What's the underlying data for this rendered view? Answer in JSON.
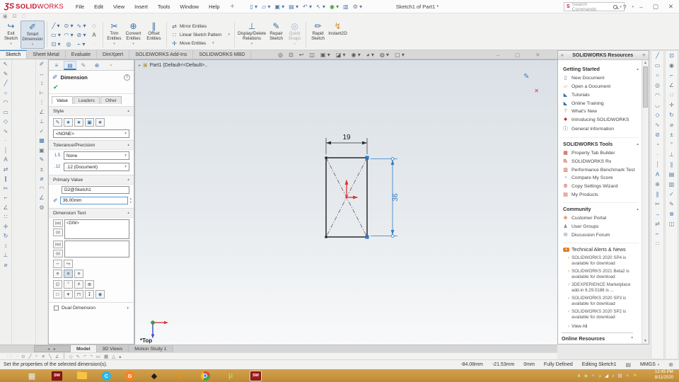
{
  "titlebar": {
    "logo_mark": "ƷS",
    "logo_solid": "SOLID",
    "logo_works": "WORKS",
    "menus": [
      "File",
      "Edit",
      "View",
      "Insert",
      "Tools",
      "Window",
      "Help"
    ],
    "quick_access": [
      {
        "name": "new-document-icon",
        "glyph": "▯ ▾"
      },
      {
        "name": "open-icon",
        "glyph": "▱ ▾"
      },
      {
        "name": "save-icon",
        "glyph": "▣ ▾"
      },
      {
        "name": "print-icon",
        "glyph": "▤ ▾"
      },
      {
        "name": "undo-icon",
        "glyph": "↶ ▾"
      },
      {
        "name": "select-icon",
        "glyph": "↖ ▾"
      },
      {
        "name": "rebuild-icon",
        "glyph": "◉ ▾",
        "color": "#3f9b3f"
      },
      {
        "name": "file-properties-icon",
        "glyph": "▥"
      },
      {
        "name": "options-icon",
        "glyph": "⚙ ▾",
        "color": "#6b7d91"
      }
    ],
    "title": "Sketch1 of Part1 *",
    "search_placeholder": "Search Commands"
  },
  "ribbon": {
    "capture_icons": [
      {
        "name": "screenshot-icon",
        "glyph": "▣"
      },
      {
        "name": "record-video-icon",
        "glyph": "⊡"
      },
      {
        "name": "image-capture-icon",
        "glyph": "▢",
        "color": "#c4c4c4"
      }
    ],
    "exit_sketch": "Exit Sketch",
    "smart_dimension": "Smart Dimension",
    "sketch_tool_icons": [
      {
        "name": "line-icon",
        "glyph": "╱ ▾"
      },
      {
        "name": "circle-icon",
        "glyph": "⊙ ▾"
      },
      {
        "name": "spline-icon",
        "glyph": "∿ ▾"
      },
      {
        "name": "polygon-icon",
        "glyph": "◇",
        "color": "#b5b5b5"
      },
      {
        "name": "corner-rectangle-icon",
        "glyph": "▭ ▾"
      },
      {
        "name": "arc-icon",
        "glyph": "◠ ▾"
      },
      {
        "name": "ellipse-icon",
        "glyph": "⊘ ▾"
      },
      {
        "name": "sketch-text-icon",
        "glyph": "A",
        "color": "#555555"
      },
      {
        "name": "slot-icon",
        "glyph": "⊡ ▾"
      },
      {
        "name": "point-icon",
        "glyph": "◎"
      },
      {
        "name": "sketch-fillet-icon",
        "glyph": "⌐ ▾"
      },
      {
        "name": "plane-icon",
        "glyph": "·",
        "color": "#b5b5b5"
      }
    ],
    "trim": "Trim Entities",
    "convert": "Convert Entities",
    "offset": "Offset Entities",
    "mirror": "Mirror Entities",
    "linear_pattern": "Linear Sketch Pattern",
    "move": "Move Entities",
    "display_delete": "Display/Delete Relations",
    "repair": "Repair Sketch",
    "quick_snaps": "Quick Snaps",
    "rapid": "Rapid Sketch",
    "instant2d": "Instant2D",
    "tabs": [
      "Sketch",
      "Sheet Metal",
      "Evaluate",
      "DimXpert",
      "SOLIDWORKS Add-Ins",
      "SOLIDWORKS MBD"
    ]
  },
  "property_panel": {
    "title": "Dimension",
    "tabs": [
      "Value",
      "Leaders",
      "Other"
    ],
    "style_label": "Style",
    "style_selected": "<NONE>",
    "tolerance_label": "Tolerance/Precision",
    "tol_icon": "1.5",
    "tolerance_type": "None",
    "prec_icon": ".12",
    "precision": ".12 (Document)",
    "primary_label": "Primary Value",
    "primary_name": "D2@Sketch1",
    "primary_value": "36.00mm",
    "dimension_text_label": "Dimension Text",
    "dim_btn1": "(xx)",
    "dim_btn2": "(x)",
    "dimension_text_value": "<DIM>",
    "dual_label": "Dual Dimension"
  },
  "viewport": {
    "feature_tree": "Part1 (Default<<Default>..",
    "view_label": "*Top",
    "width_dim": "19",
    "height_dim": "36",
    "doc_tabs": [
      "Model",
      "3D Views",
      "Motion Study 1"
    ],
    "headsup_icons": [
      {
        "name": "zoom-fit-icon",
        "glyph": "◎"
      },
      {
        "name": "zoom-area-icon",
        "glyph": "⊡"
      },
      {
        "name": "previous-view-icon",
        "glyph": "↩"
      },
      {
        "name": "section-view-icon",
        "glyph": "◫"
      },
      {
        "name": "view-orientation-icon",
        "glyph": "▣ ▾"
      },
      {
        "name": "display-style-icon",
        "glyph": "◪ ▾"
      },
      {
        "name": "hide-show-items-icon",
        "glyph": "◉ ▾"
      },
      {
        "name": "edit-appearance-icon",
        "glyph": "◕ ▾"
      },
      {
        "name": "apply-scene-icon",
        "glyph": "◍ ▾"
      },
      {
        "name": "view-settings-icon",
        "glyph": "▢ ▾"
      }
    ]
  },
  "task_pane": {
    "title": "SOLIDWORKS Resources",
    "getting_started": {
      "title": "Getting Started",
      "items": [
        {
          "name": "new-document",
          "label": "New Document",
          "glyph": "▯",
          "color": "#5b7aa8"
        },
        {
          "name": "open-a-document",
          "label": "Open a Document",
          "glyph": "▱",
          "color": "#d9a13b"
        },
        {
          "name": "tutorials",
          "label": "Tutorials",
          "glyph": "◣",
          "color": "#2e6da4"
        },
        {
          "name": "online-training",
          "label": "Online Training",
          "glyph": "◣",
          "color": "#2e6da4"
        },
        {
          "name": "whats-new",
          "label": "What's New",
          "glyph": "?",
          "color": "#e08a2e"
        },
        {
          "name": "introducing-solidworks",
          "label": "Introducing SOLIDWORKS",
          "glyph": "✸",
          "color": "#c0392b"
        },
        {
          "name": "general-information",
          "label": "General Information",
          "glyph": "ⓘ",
          "color": "#2e6da4"
        }
      ]
    },
    "tools": {
      "title": "SOLIDWORKS Tools",
      "items": [
        {
          "name": "property-tab-builder",
          "label": "Property Tab Builder",
          "glyph": "▦",
          "color": "#c0392b"
        },
        {
          "name": "solidworks-rx",
          "label": "SOLIDWORKS Rx",
          "glyph": "℞",
          "color": "#c0392b"
        },
        {
          "name": "performance-benchmark-test",
          "label": "Performance Benchmark Test",
          "glyph": "▥",
          "color": "#c0392b"
        },
        {
          "name": "compare-my-score",
          "label": "Compare My Score",
          "glyph": "◔",
          "color": "#2980b9"
        },
        {
          "name": "copy-settings-wizard",
          "label": "Copy Settings Wizard",
          "glyph": "⚙",
          "color": "#c0392b"
        },
        {
          "name": "my-products",
          "label": "My Products",
          "glyph": "▤",
          "color": "#c0392b"
        }
      ]
    },
    "community": {
      "title": "Community",
      "items": [
        {
          "name": "customer-portal",
          "label": "Customer Portal",
          "glyph": "⊕",
          "color": "#d35400"
        },
        {
          "name": "user-groups",
          "label": "User Groups",
          "glyph": "♟",
          "color": "#7f8c8d"
        },
        {
          "name": "discussion-forum",
          "label": "Discussion Forum",
          "glyph": "✉",
          "color": "#5b7aa8"
        }
      ]
    },
    "alerts": {
      "title": "Technical Alerts & News",
      "items": [
        "SOLIDWORKS 2020 SP4 is available for download",
        "SOLIDWORKS 2021 Beta2 is available for download",
        "3DEXPERIENCE Marketplace add-in 6.29.0188 is ...",
        "SOLIDWORKS 2020 SP3 is available for download",
        "SOLIDWORKS 2020 SP2 is available for download"
      ],
      "view_all": "View All"
    },
    "online_resources": "Online Resources"
  },
  "toolbars": {
    "left_primary": [
      {
        "name": "select-icon",
        "glyph": "↖"
      },
      {
        "name": "sketch-icon",
        "glyph": "✎"
      },
      {
        "name": "line-icon",
        "glyph": "╱"
      },
      {
        "name": "circle-icon",
        "glyph": "○"
      },
      {
        "name": "arc-icon",
        "glyph": "◠"
      },
      {
        "name": "rectangle-icon",
        "glyph": "▭"
      },
      {
        "name": "polygon-icon",
        "glyph": "◇"
      },
      {
        "name": "spline-icon",
        "glyph": "∿"
      },
      {
        "name": "point-icon",
        "glyph": "·"
      },
      {
        "name": "centerline-icon",
        "glyph": "┆"
      },
      {
        "name": "text-icon",
        "glyph": "A"
      },
      {
        "name": "mirror-icon",
        "glyph": "⇄"
      },
      {
        "name": "offset-icon",
        "glyph": "∥"
      },
      {
        "name": "trim-icon",
        "glyph": "✂"
      },
      {
        "name": "fillet-icon",
        "glyph": "⌐"
      },
      {
        "name": "chamfer-icon",
        "glyph": "∠"
      },
      {
        "name": "pattern-icon",
        "glyph": "∷"
      },
      {
        "name": "move-icon",
        "glyph": "✛"
      },
      {
        "name": "rotate-icon",
        "glyph": "↻"
      },
      {
        "name": "stretch-icon",
        "glyph": "↕"
      },
      {
        "name": "relations-icon",
        "glyph": "⊥"
      },
      {
        "name": "dimension-icon",
        "glyph": "⌀"
      }
    ],
    "left_secondary": [
      {
        "name": "smart-dimension-icon",
        "glyph": "✐"
      },
      {
        "name": "horizontal-dimension-icon",
        "glyph": "↔"
      },
      {
        "name": "vertical-dimension-icon",
        "glyph": "↕"
      },
      {
        "name": "baseline-dimension-icon",
        "glyph": "⊢"
      },
      {
        "name": "ordinate-dimension-icon",
        "glyph": "⋮"
      },
      {
        "name": "angle-dimension-icon",
        "glyph": "∠"
      },
      {
        "name": "add-relation-icon",
        "glyph": "⊥"
      },
      {
        "name": "display-relations-icon",
        "glyph": "✓"
      },
      {
        "name": "fully-define-sketch-icon",
        "glyph": "▦"
      },
      {
        "name": "sketch-picture-icon",
        "glyph": "▣"
      },
      {
        "name": "modify-sketch-icon",
        "glyph": "✎"
      },
      {
        "name": "numeric-input-icon",
        "glyph": "±"
      },
      {
        "name": "diameter-dimension-icon",
        "glyph": "⌀"
      },
      {
        "name": "radius-dimension-icon",
        "glyph": "◠"
      },
      {
        "name": "chamfer-dimension-icon",
        "glyph": "∠"
      },
      {
        "name": "settings-icon",
        "glyph": "⚙"
      }
    ],
    "right_primary": [
      {
        "name": "line-icon",
        "glyph": "╱"
      },
      {
        "name": "rectangle-icon",
        "glyph": "▭"
      },
      {
        "name": "circle-icon",
        "glyph": "○"
      },
      {
        "name": "perimeter-circle-icon",
        "glyph": "◎"
      },
      {
        "name": "centerpoint-arc-icon",
        "glyph": "◠"
      },
      {
        "name": "tangent-arc-icon",
        "glyph": "◡"
      },
      {
        "name": "polygon-icon",
        "glyph": "◇"
      },
      {
        "name": "spline-icon",
        "glyph": "∿"
      },
      {
        "name": "ellipse-icon",
        "glyph": "⊘"
      },
      {
        "name": "partial-ellipse-icon",
        "glyph": "◔"
      },
      {
        "name": "point-icon",
        "glyph": "·"
      },
      {
        "name": "centerline-icon",
        "glyph": "┆"
      },
      {
        "name": "text-icon",
        "glyph": "A"
      },
      {
        "name": "convert-entities-icon",
        "glyph": "⊕"
      },
      {
        "name": "offset-entities-icon",
        "glyph": "∥"
      },
      {
        "name": "trim-entities-icon",
        "glyph": "✂"
      },
      {
        "name": "extend-entities-icon",
        "glyph": "→"
      },
      {
        "name": "mirror-entities-icon",
        "glyph": "⇄"
      },
      {
        "name": "fillet-icon",
        "glyph": "⌐"
      },
      {
        "name": "pattern-icon",
        "glyph": "∷"
      }
    ],
    "right_secondary": [
      {
        "name": "slot-icon",
        "glyph": "⊡"
      },
      {
        "name": "perimeter-icon",
        "glyph": "◉"
      },
      {
        "name": "corner-icon",
        "glyph": "⌐"
      },
      {
        "name": "angle-icon",
        "glyph": "∠"
      },
      {
        "name": "linear-pattern-icon",
        "glyph": "∷"
      },
      {
        "name": "move-icon",
        "glyph": "✛"
      },
      {
        "name": "rotate-icon",
        "glyph": "↻"
      },
      {
        "name": "diameter-icon",
        "glyph": "⌀"
      },
      {
        "name": "tolerance-icon",
        "glyph": "±"
      },
      {
        "name": "degree-icon",
        "glyph": "°"
      },
      {
        "name": "perpendicular-icon",
        "glyph": "⊥"
      },
      {
        "name": "parallel-icon",
        "glyph": "∥"
      },
      {
        "name": "table-icon",
        "glyph": "▤"
      },
      {
        "name": "grid-icon",
        "glyph": "▥"
      },
      {
        "name": "check-sketch-icon",
        "glyph": "✓"
      },
      {
        "name": "edit-icon",
        "glyph": "✎"
      },
      {
        "name": "erase-icon",
        "glyph": "⊗"
      },
      {
        "name": "section-icon",
        "glyph": "◫"
      }
    ],
    "selection_filter": [
      {
        "name": "filter-toggle-icon",
        "glyph": "·"
      },
      {
        "name": "filter-vertices-icon",
        "glyph": "⊙"
      },
      {
        "name": "filter-edges-icon",
        "glyph": "╱"
      },
      {
        "name": "filter-faces-icon",
        "glyph": "○"
      },
      {
        "name": "clear-filters-icon",
        "glyph": "✕"
      },
      {
        "name": "filter-midpoints-icon",
        "glyph": "╲"
      },
      {
        "name": "filter-angle-icon",
        "glyph": "∠"
      },
      {
        "name": "filter-axes-icon",
        "glyph": "│"
      },
      {
        "name": "filter-planes-icon",
        "glyph": "◇"
      },
      {
        "name": "filter-select-icon",
        "glyph": "↖"
      },
      {
        "name": "filter-corner-icon",
        "glyph": "⌐"
      },
      {
        "name": "filter-not-icon",
        "glyph": "¬"
      },
      {
        "name": "filter-surface-icon",
        "glyph": "▭"
      },
      {
        "name": "filter-mesh-icon",
        "glyph": "▦"
      },
      {
        "name": "filter-triangle-icon",
        "glyph": "△"
      },
      {
        "name": "filter-more-icon",
        "glyph": "▴"
      }
    ]
  },
  "status_bar": {
    "message": "Set the properties of the selected dimension(s).",
    "x": "-84.08mm",
    "y": "-21.53mm",
    "z": "0mm",
    "state": "Fully Defined",
    "mode": "Editing Sketch1",
    "units": "MMGS"
  },
  "taskbar": {
    "apps": [
      {
        "name": "start-button"
      },
      {
        "name": "taskbar-calculator",
        "glyph": "▦"
      },
      {
        "name": "taskbar-solidworks-2016",
        "glyph": "SW"
      },
      {
        "name": "taskbar-file-explorer"
      },
      {
        "name": "taskbar-app-c",
        "glyph": "C"
      },
      {
        "name": "taskbar-gom-player",
        "glyph": "G"
      },
      {
        "name": "taskbar-inkscape",
        "glyph": "◆"
      },
      {
        "name": "taskbar-vlc",
        "glyph": "▲"
      },
      {
        "name": "taskbar-chrome"
      },
      {
        "name": "taskbar-utorrent",
        "glyph": "µ"
      },
      {
        "name": "taskbar-solidworks-active",
        "glyph": "SW"
      }
    ],
    "tray": [
      {
        "name": "tray-chevron-icon",
        "glyph": "∧",
        "color": "#ffffff"
      },
      {
        "name": "tray-shield-icon",
        "glyph": "◆",
        "color": "#b7e28a"
      },
      {
        "name": "tray-graphics-icon",
        "glyph": "✦",
        "color": "#8ad0f0"
      },
      {
        "name": "tray-utorrent-icon",
        "glyph": "µ",
        "color": "#c6e97a"
      },
      {
        "name": "tray-network-icon",
        "glyph": "◢",
        "color": "#ffffff"
      },
      {
        "name": "tray-volume-icon",
        "glyph": "♪",
        "color": "#ffffff"
      },
      {
        "name": "tray-onedrive-icon",
        "glyph": "▤",
        "color": "#e8e8e8"
      },
      {
        "name": "tray-bluetooth-icon",
        "glyph": "✧",
        "color": "#cfe3f5"
      },
      {
        "name": "tray-flag-icon",
        "glyph": "⚑",
        "color": "#f0c040"
      }
    ],
    "time": "12:45 PM",
    "date": "8/11/2020"
  }
}
